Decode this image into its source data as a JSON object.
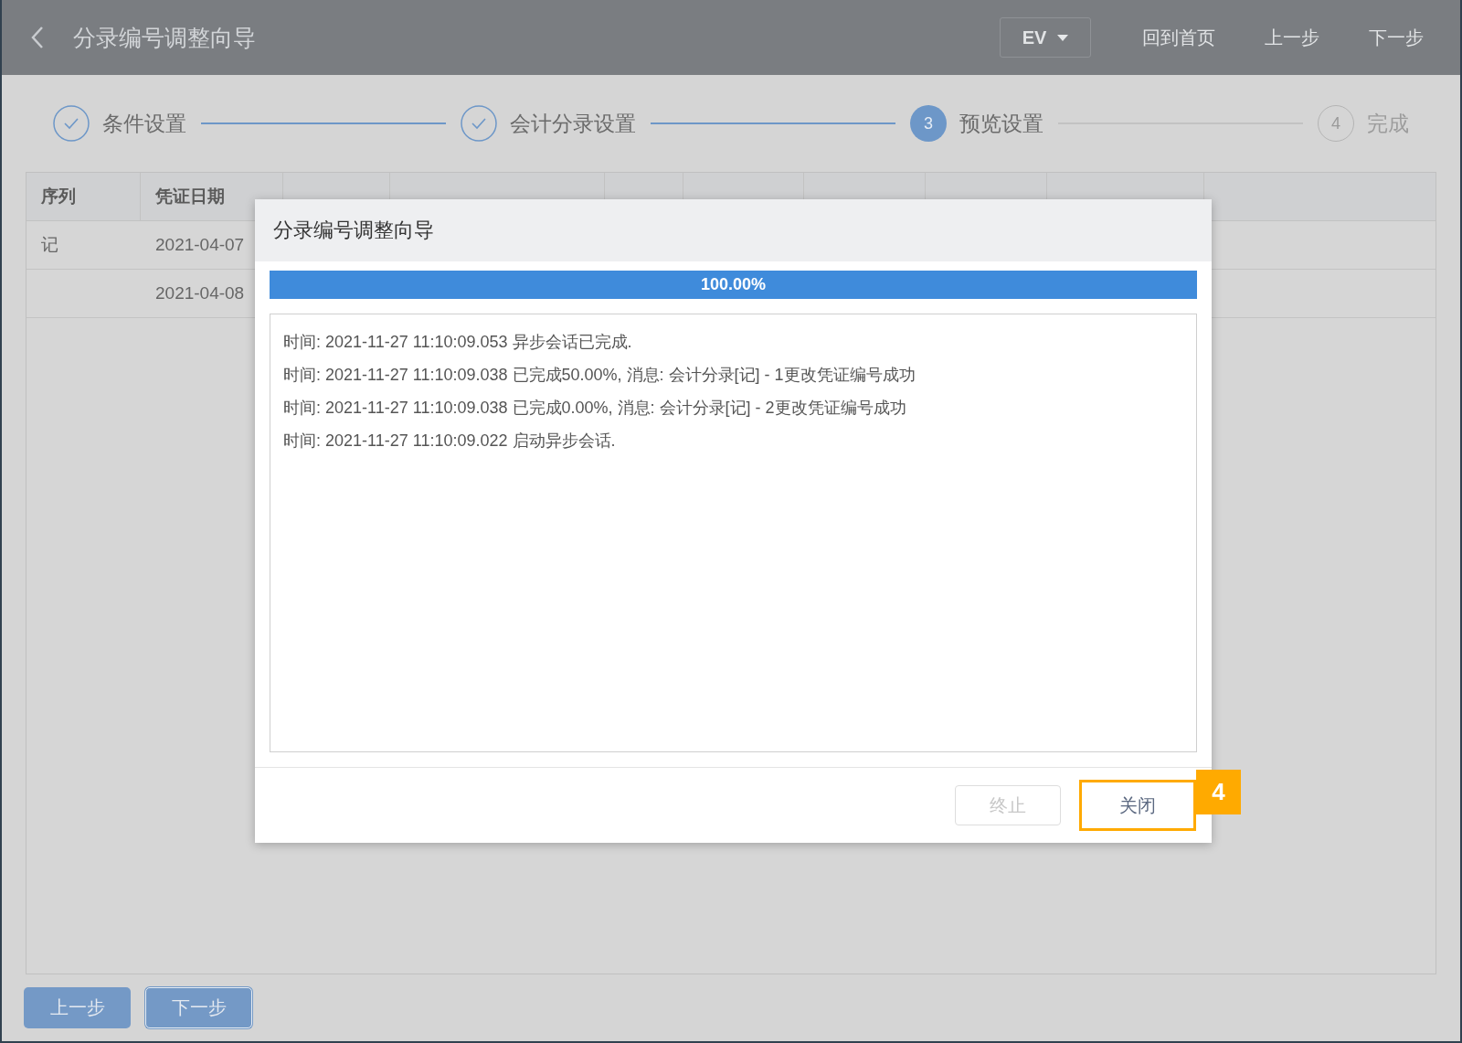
{
  "header": {
    "title": "分录编号调整向导",
    "dropdown": "EV",
    "links": [
      "回到首页",
      "上一步",
      "下一步"
    ]
  },
  "steps": [
    {
      "label": "条件设置",
      "completed": true,
      "selected": false
    },
    {
      "label": "会计分录设置",
      "completed": true,
      "selected": false
    },
    {
      "label": "预览设置",
      "completed": false,
      "selected": true,
      "number": "3"
    },
    {
      "label": "完成",
      "completed": false,
      "selected": false,
      "number": "4"
    }
  ],
  "table": {
    "columns": [
      "序列",
      "凭证日期"
    ],
    "rows": [
      {
        "series": "记",
        "date": "2021-04-07"
      },
      {
        "date": "2021-04-08"
      }
    ]
  },
  "modal": {
    "title": "分录编号调整向导",
    "progress": {
      "level": 1,
      "label": "100.00%"
    },
    "log": [
      "时间: 2021-11-27 11:10:09.053 异步会话已完成.",
      "时间: 2021-11-27 11:10:09.038 已完成50.00%, 消息: 会计分录[记] - 1更改凭证编号成功",
      "时间: 2021-11-27 11:10:09.038 已完成0.00%, 消息: 会计分录[记] - 2更改凭证编号成功",
      "时间: 2021-11-27 11:10:09.022 启动异步会话."
    ],
    "buttons": [
      {
        "label": "终止",
        "disabled": true,
        "highlighted": false
      },
      {
        "label": "关闭",
        "disabled": false,
        "highlighted": true
      }
    ],
    "callout": "4"
  },
  "footer_buttons": [
    {
      "label": "上一步",
      "focused": false
    },
    {
      "label": "下一步",
      "focused": true
    }
  ]
}
